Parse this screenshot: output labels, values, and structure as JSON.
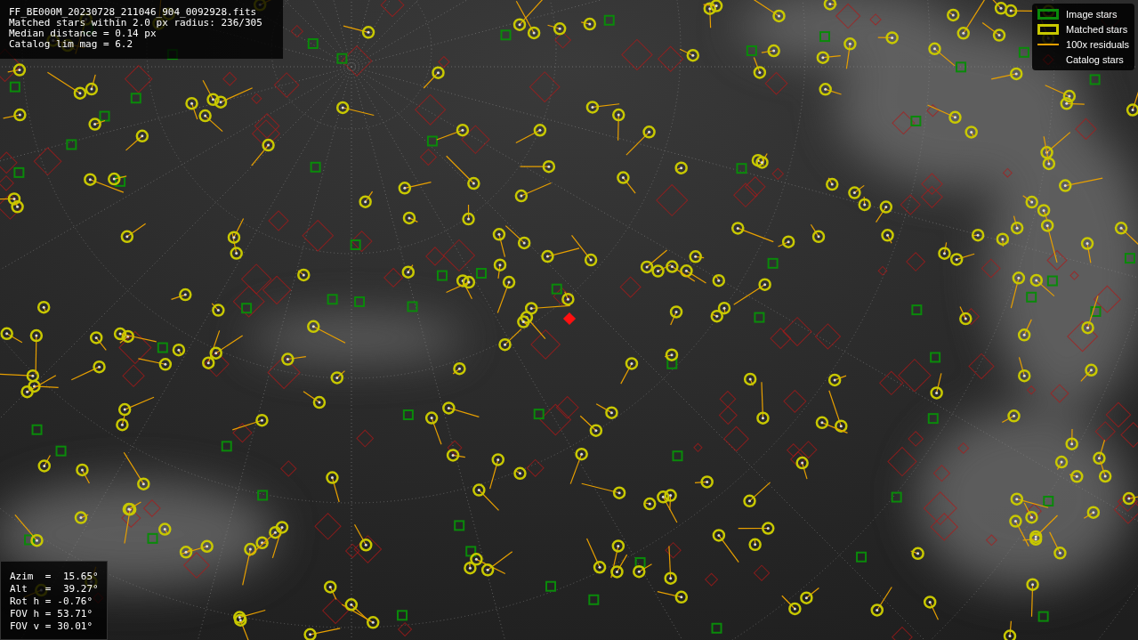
{
  "info_box": {
    "lines": [
      "FF_BE000M_20230728_211046_904_0092928.fits",
      "Matched stars within 2.0 px radius: 236/305",
      "Median distance = 0.14 px",
      "Catalog lim mag = 6.2"
    ]
  },
  "legend": {
    "items": [
      {
        "kind": "box",
        "label": "Image stars",
        "color": "#0a8a0a"
      },
      {
        "kind": "box",
        "label": "Matched stars",
        "color": "#c8c800"
      },
      {
        "kind": "line",
        "label": "100x residuals",
        "color": "#e8a000"
      },
      {
        "kind": "diamond",
        "label": "Catalog stars",
        "color": "#2a0808"
      }
    ]
  },
  "pointing_box": {
    "rows": [
      {
        "label": "Azim  =",
        "value": " 15.65°"
      },
      {
        "label": "Alt   =",
        "value": " 39.27°"
      },
      {
        "label": "Rot h =",
        "value": "-0.76°"
      },
      {
        "label": "FOV h =",
        "value": "53.71°"
      },
      {
        "label": "FOV v =",
        "value": "30.01°"
      }
    ]
  }
}
